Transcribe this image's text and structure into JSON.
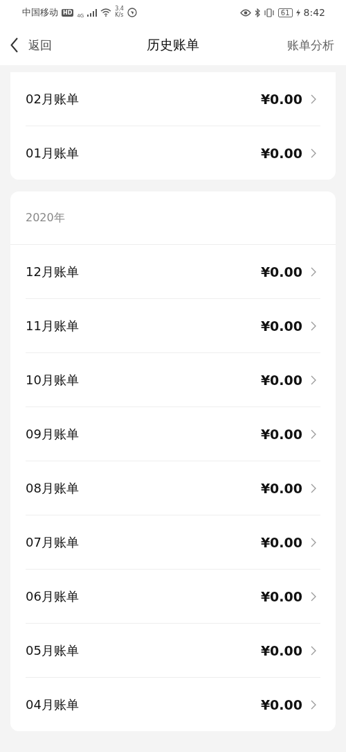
{
  "status_bar": {
    "carrier": "中国移动",
    "hd": "HD",
    "network": "4G",
    "speed_value": "3.4",
    "speed_unit": "K/s",
    "battery": "61",
    "time": "8:42"
  },
  "nav": {
    "back": "返回",
    "title": "历史账单",
    "action": "账单分析"
  },
  "sections": [
    {
      "rows": [
        {
          "label": "02月账单",
          "amount": "¥0.00"
        },
        {
          "label": "01月账单",
          "amount": "¥0.00"
        }
      ]
    },
    {
      "year": "2020年",
      "rows": [
        {
          "label": "12月账单",
          "amount": "¥0.00"
        },
        {
          "label": "11月账单",
          "amount": "¥0.00"
        },
        {
          "label": "10月账单",
          "amount": "¥0.00"
        },
        {
          "label": "09月账单",
          "amount": "¥0.00"
        },
        {
          "label": "08月账单",
          "amount": "¥0.00"
        },
        {
          "label": "07月账单",
          "amount": "¥0.00"
        },
        {
          "label": "06月账单",
          "amount": "¥0.00"
        },
        {
          "label": "05月账单",
          "amount": "¥0.00"
        },
        {
          "label": "04月账单",
          "amount": "¥0.00"
        }
      ]
    }
  ]
}
